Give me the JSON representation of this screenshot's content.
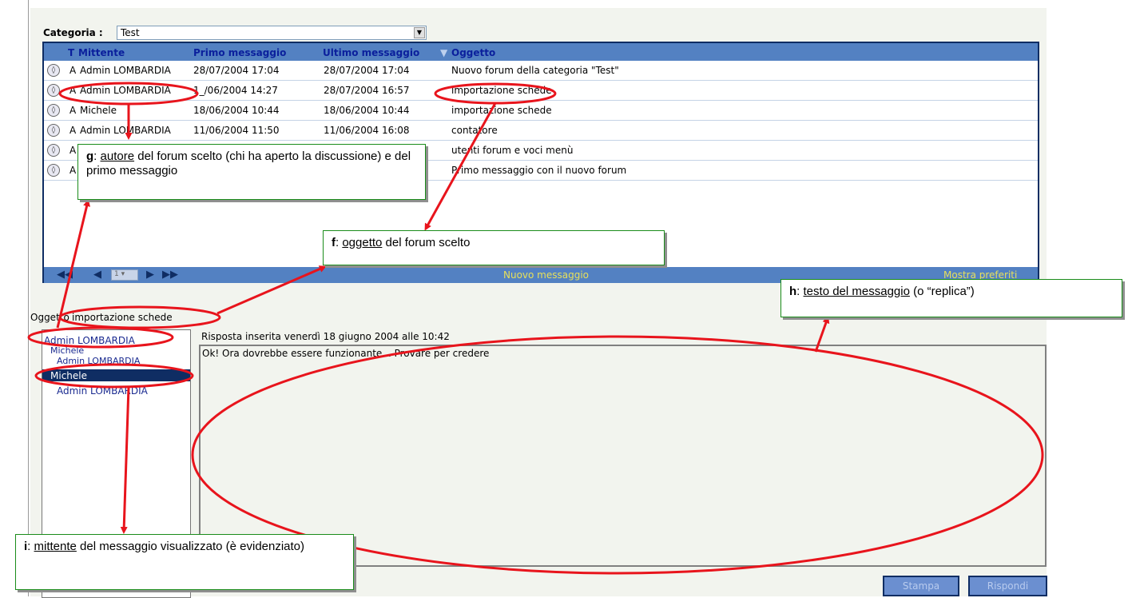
{
  "category": {
    "label": "Categoria :",
    "value": "Test"
  },
  "grid": {
    "headers": {
      "t": "T",
      "sender": "Mittente",
      "first": "Primo messaggio",
      "last": "Ultimo messaggio",
      "subject": "Oggetto"
    },
    "rows": [
      {
        "t": "A",
        "sender": "Admin LOMBARDIA",
        "first": "28/07/2004 17:04",
        "last": "28/07/2004 17:04",
        "subject": "Nuovo forum della categoria \"Test\""
      },
      {
        "t": "A",
        "sender": "Admin LOMBARDIA",
        "first": "1_/06/2004 14:27",
        "last": "28/07/2004 16:57",
        "subject": "importazione schede"
      },
      {
        "t": "A",
        "sender": "Michele",
        "first": "18/06/2004 10:44",
        "last": "18/06/2004 10:44",
        "subject": "importazione schede"
      },
      {
        "t": "A",
        "sender": "Admin LOMBARDIA",
        "first": "11/06/2004 11:50",
        "last": "11/06/2004 16:08",
        "subject": "contatore"
      },
      {
        "t": "A",
        "sender": "",
        "first": "",
        "last": "",
        "subject": "utenti forum e voci menù"
      },
      {
        "t": "A",
        "sender": "",
        "first": "",
        "last": "",
        "subject": "Primo messaggio con il nuovo forum"
      }
    ],
    "footer": {
      "page": "1",
      "new_message": "Nuovo messaggio",
      "show_favorites": "Mostra preferiti"
    }
  },
  "subject": {
    "label": "Oggetto",
    "value": "importazione schede"
  },
  "tree": {
    "nodes": [
      "Admin LOMBARDIA",
      "Michele",
      "Admin LOMBARDIA",
      "Michele",
      "Admin LOMBARDIA"
    ]
  },
  "message": {
    "info": "Risposta inserita venerdì 18 giugno 2004 alle 10:42",
    "text": "Ok! Ora dovrebbe essere funzionante... Provare per credere"
  },
  "buttons": {
    "print": "Stampa",
    "reply": "Rispondi"
  },
  "callouts": {
    "g": {
      "letter": "g",
      "term": "autore",
      "text": " del forum scelto (chi ha aperto la discussione) e del primo messaggio"
    },
    "f": {
      "letter": "f",
      "term": "oggetto",
      "text": " del forum scelto"
    },
    "h": {
      "letter": "h",
      "term": "testo del messaggio",
      "text": " (o “replica”)"
    },
    "i": {
      "letter": "i",
      "term": "mittente",
      "text": " del messaggio visualizzato (è evidenziato)"
    }
  },
  "colors": {
    "header": "#5381c2",
    "selection": "#0f2d63",
    "annotation": "#e8141c",
    "callout_border": "#1a8c1a",
    "footer_text": "#e8e05a"
  }
}
